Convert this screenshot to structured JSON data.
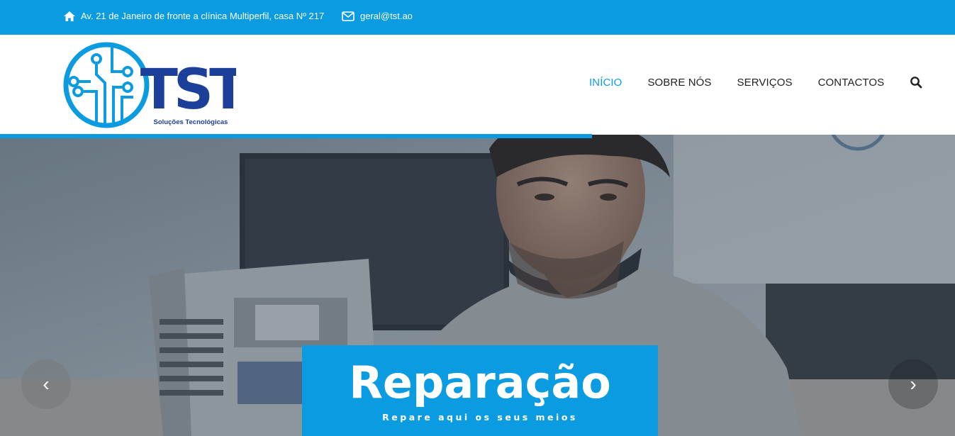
{
  "topbar": {
    "address": "Av. 21 de Janeiro de fronte a clínica Multiperfil, casa Nº 217",
    "email": "geral@tst.ao",
    "address_icon": "home-icon",
    "email_icon": "envelope-icon"
  },
  "logo": {
    "text": "TST",
    "tagline": "Soluções Tecnológicas"
  },
  "nav": {
    "items": [
      {
        "label": "INÍCIO",
        "active": true
      },
      {
        "label": "SOBRE NÓS",
        "active": false
      },
      {
        "label": "SERVIÇOS",
        "active": false
      },
      {
        "label": "CONTACTOS",
        "active": false
      }
    ],
    "search_icon": "search-icon"
  },
  "slider": {
    "progress": 0.62,
    "caption_title": "Reparação",
    "caption_subtitle": "Repare aqui os seus meios",
    "prev_symbol": "‹",
    "next_symbol": "›"
  },
  "colors": {
    "brand_blue": "#0a9be1",
    "logo_dark_blue": "#1c3f9a"
  }
}
